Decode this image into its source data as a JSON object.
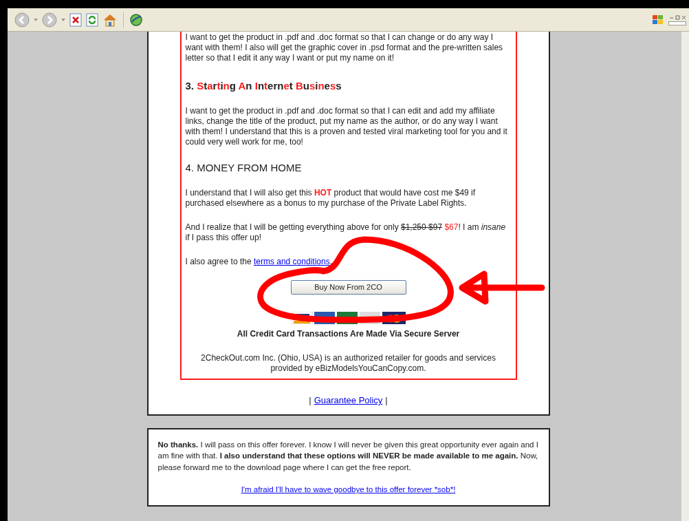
{
  "page": {
    "intro": "I want to get the product in .pdf and .doc format so that I can change or do any way I want with them! I also will get the graphic cover in .psd format and the pre-written sales letter so that I edit it any way I want or put my name on it!",
    "heading_3": [
      {
        "text": "3. ",
        "red": false
      },
      {
        "text": "S",
        "red": true
      },
      {
        "text": "t",
        "red": false
      },
      {
        "text": "a",
        "red": true
      },
      {
        "text": "r",
        "red": false
      },
      {
        "text": "t",
        "red": true
      },
      {
        "text": "i",
        "red": false
      },
      {
        "text": "n",
        "red": true
      },
      {
        "text": "g ",
        "red": false
      },
      {
        "text": "A",
        "red": true
      },
      {
        "text": "n ",
        "red": false
      },
      {
        "text": "I",
        "red": true
      },
      {
        "text": "n",
        "red": false
      },
      {
        "text": "t",
        "red": true
      },
      {
        "text": "ern",
        "red": false
      },
      {
        "text": "e",
        "red": true
      },
      {
        "text": "t ",
        "red": false
      },
      {
        "text": "B",
        "red": true
      },
      {
        "text": "u",
        "red": false
      },
      {
        "text": "s",
        "red": true
      },
      {
        "text": "i",
        "red": false
      },
      {
        "text": "n",
        "red": true
      },
      {
        "text": "e",
        "red": false
      },
      {
        "text": "s",
        "red": true
      },
      {
        "text": "s",
        "red": false
      }
    ],
    "para_3": "I want to get the product in .pdf and .doc format so that I can edit and add my affiliate links, change the title of the product, put my name as the author, or do any way I want with them! I understand that this is a proven and tested viral marketing tool for you and it could very well work for me, too!",
    "heading_4": "4. MONEY FROM HOME",
    "para_4": [
      {
        "kind": "plain",
        "text": "I understand that I will also get this "
      },
      {
        "kind": "red_bold",
        "text": "HOT"
      },
      {
        "kind": "plain",
        "text": " product that would have cost me $49 if purchased elsewhere as a bonus to my purchase of the Private Label Rights."
      }
    ],
    "price_para": [
      {
        "kind": "plain",
        "text": "And I realize that I will be getting everything above for only "
      },
      {
        "kind": "strike",
        "text": "$1,250 $97"
      },
      {
        "kind": "red",
        "text": " $67"
      },
      {
        "kind": "plain",
        "text": "! I am "
      },
      {
        "kind": "italic",
        "text": "insane"
      },
      {
        "kind": "plain",
        "text": " if I pass this offer up!"
      }
    ],
    "agree_text": "I also agree to the",
    "agree_link": "terms and conditions",
    "agree_end": ".",
    "buy_button": "Buy Now From 2CO",
    "secure_note": "All Credit Card Transactions Are Made Via Secure Server",
    "retailer_note": "2CheckOut.com Inc. (Ohio, USA) is an authorized retailer for goods and services provided by eBizModelsYouCanCopy.com.",
    "guarantee_left": "|",
    "guarantee_link": "Guarantee Policy",
    "guarantee_right": "|",
    "decline_text": "**No thanks.** I will pass on this offer forever. I know I will never be given this great opportunity ever again and I am fine with that. **I also understand that these options will NEVER be made available to me again.** Now, please forward me to the download page where I can get the free report.",
    "decline_link": "I'm afraid I'll have to wave goodbye to this offer forever *sob*!"
  }
}
